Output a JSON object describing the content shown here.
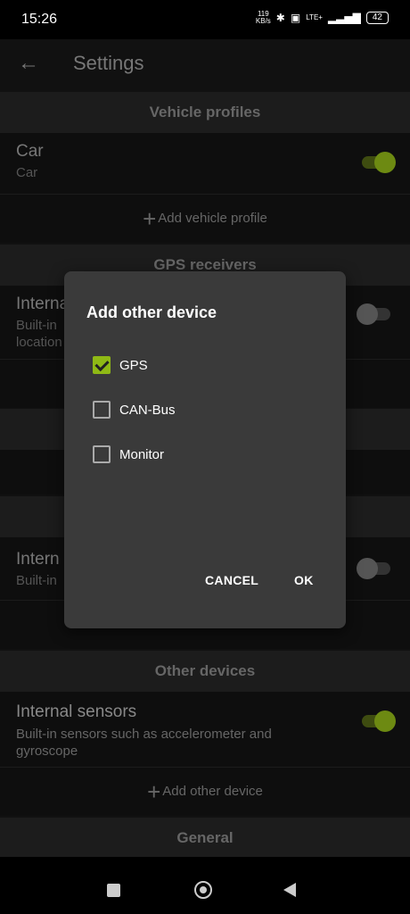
{
  "status_bar": {
    "time": "15:26",
    "speed_value": "119",
    "speed_unit": "KB/s",
    "network": "LTE+",
    "battery": "42"
  },
  "app_bar": {
    "title": "Settings"
  },
  "sections": {
    "vehicle_profiles": {
      "header": "Vehicle profiles",
      "profile_title": "Car",
      "profile_subtitle": "Car",
      "profile_enabled": true,
      "add_label": "Add vehicle profile"
    },
    "gps_receivers": {
      "header": "GPS receivers",
      "item_title": "Internal",
      "item_subtitle_1": "Built-in",
      "item_subtitle_2": "location",
      "item_enabled": false
    },
    "second_internal": {
      "item_title": "Intern",
      "item_subtitle": "Built-in",
      "item_enabled": false
    },
    "other_devices": {
      "header": "Other devices",
      "item_title": "Internal sensors",
      "item_subtitle": "Built-in sensors such as accelerometer and gyroscope",
      "item_enabled": true,
      "add_label": "Add other device"
    },
    "general": {
      "header": "General"
    }
  },
  "dialog": {
    "title": "Add other device",
    "options": [
      {
        "label": "GPS",
        "checked": true
      },
      {
        "label": "CAN-Bus",
        "checked": false
      },
      {
        "label": "Monitor",
        "checked": false
      }
    ],
    "cancel_label": "CANCEL",
    "ok_label": "OK"
  },
  "colors": {
    "accent": "#8fb915",
    "dialog_bg": "#3a3a3a"
  }
}
